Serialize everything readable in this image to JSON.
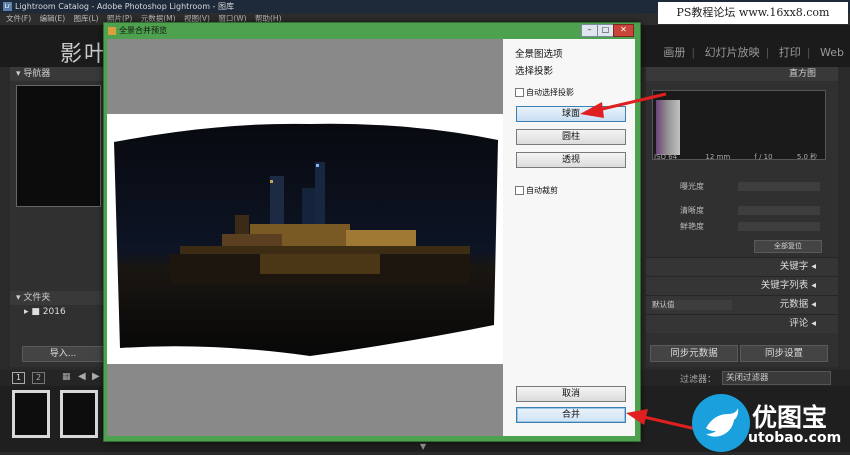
{
  "window": {
    "title": "Lightroom Catalog - Adobe Photoshop Lightroom - 图库",
    "app_icon": "Lr",
    "menu": [
      "文件(F)",
      "编辑(E)",
      "图库(L)",
      "照片(P)",
      "元数据(M)",
      "视图(V)",
      "窗口(W)",
      "帮助(H)"
    ]
  },
  "watermark": "PS教程论坛 www.16xx8.com",
  "identity_plate": "影叶",
  "modules": [
    "画册",
    "幻灯片放映",
    "打印",
    "Web"
  ],
  "left_panel": {
    "navigator_label": "导航器",
    "folders_label": "文件夹",
    "folder_year": "2016",
    "import_button": "导入..."
  },
  "right_panel": {
    "histogram_label": "直方图",
    "exif": [
      "ISO 64",
      "12 mm",
      "f / 10",
      "5.0 秒"
    ],
    "quick_develop": {
      "exposure": "曝光度",
      "clarity": "清晰度",
      "vibrance": "鲜艳度",
      "reset_all": "全部复位"
    },
    "keywording": "关键字",
    "keyword_list": "关键字列表",
    "metadata": "元数据",
    "metadata_preset": "默认值",
    "comments": "评论",
    "sync_metadata": "同步元数据",
    "sync_settings": "同步设置"
  },
  "filmstrip": {
    "pages": [
      "1",
      "2"
    ],
    "filter_label": "过滤器：",
    "filter_value": "关闭过滤器"
  },
  "dialog": {
    "title": "全景合并预览",
    "options_title": "全景图选项",
    "projection_title": "选择投影",
    "auto_select_projection": "自动选择投影",
    "projections": [
      "球面",
      "圆柱",
      "透视"
    ],
    "selected_projection": "球面",
    "auto_crop": "自动裁剪",
    "cancel_button": "取消",
    "merge_button": "合并"
  },
  "logo": {
    "name": "优图宝",
    "url": "utobao.com"
  },
  "colors": {
    "dialog_frame": "#4ea14e",
    "annotation_arrow": "#e02020",
    "logo_blue": "#1aa0dc",
    "lr_background": "#2a2a2a"
  }
}
